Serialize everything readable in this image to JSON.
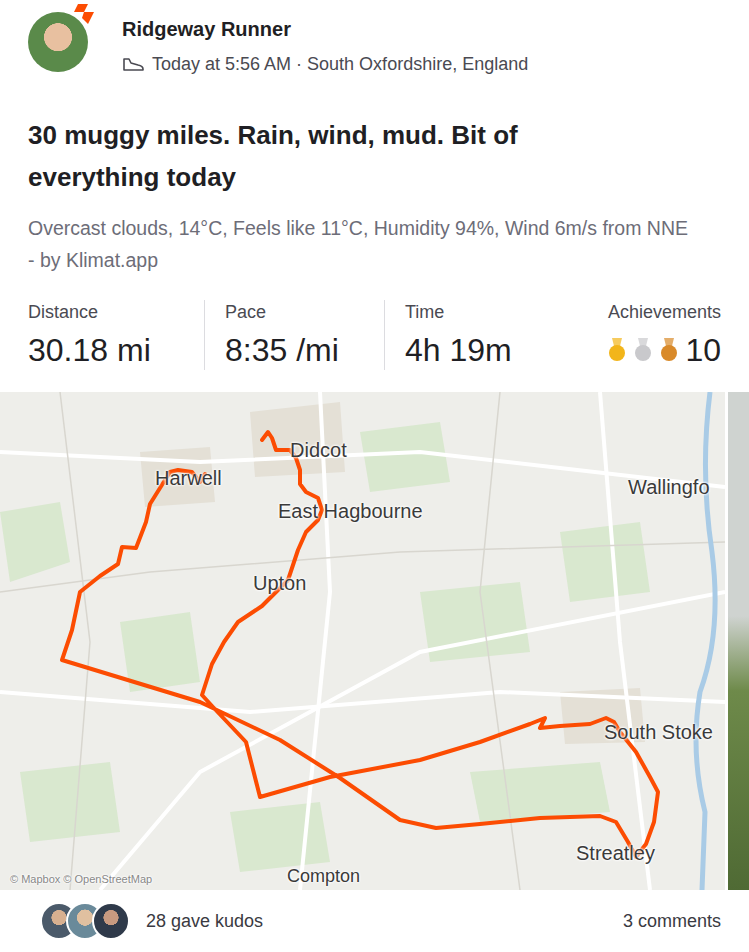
{
  "athlete": {
    "name": "Ridgeway Runner",
    "meta": "Today at 5:56 AM · South Oxfordshire, England"
  },
  "title": "30 muggy miles. Rain, wind, mud. Bit of everything today",
  "weather": "Overcast clouds, 14°C, Feels like 11°C, Humidity 94%, Wind 6m/s from NNE - by Klimat.app",
  "stats": [
    {
      "label": "Distance",
      "value": "30.18 mi"
    },
    {
      "label": "Pace",
      "value": "8:35 /mi"
    },
    {
      "label": "Time",
      "value": "4h 19m"
    }
  ],
  "achievements": {
    "label": "Achievements",
    "medals": [
      {
        "name": "gold",
        "color": "#f2b51a"
      },
      {
        "name": "silver",
        "color": "#c9c9cc"
      },
      {
        "name": "bronze",
        "color": "#d98a2a"
      }
    ],
    "count": "10"
  },
  "map": {
    "labels": [
      "Didcot",
      "Harwell",
      "Wallingfo",
      "East Hagbourne",
      "Upton",
      "South Stoke",
      "Streatley",
      "Compton",
      "© Mapbox © OpenStreetMap"
    ]
  },
  "kudos": "28 gave kudos",
  "comments": "3 comments"
}
